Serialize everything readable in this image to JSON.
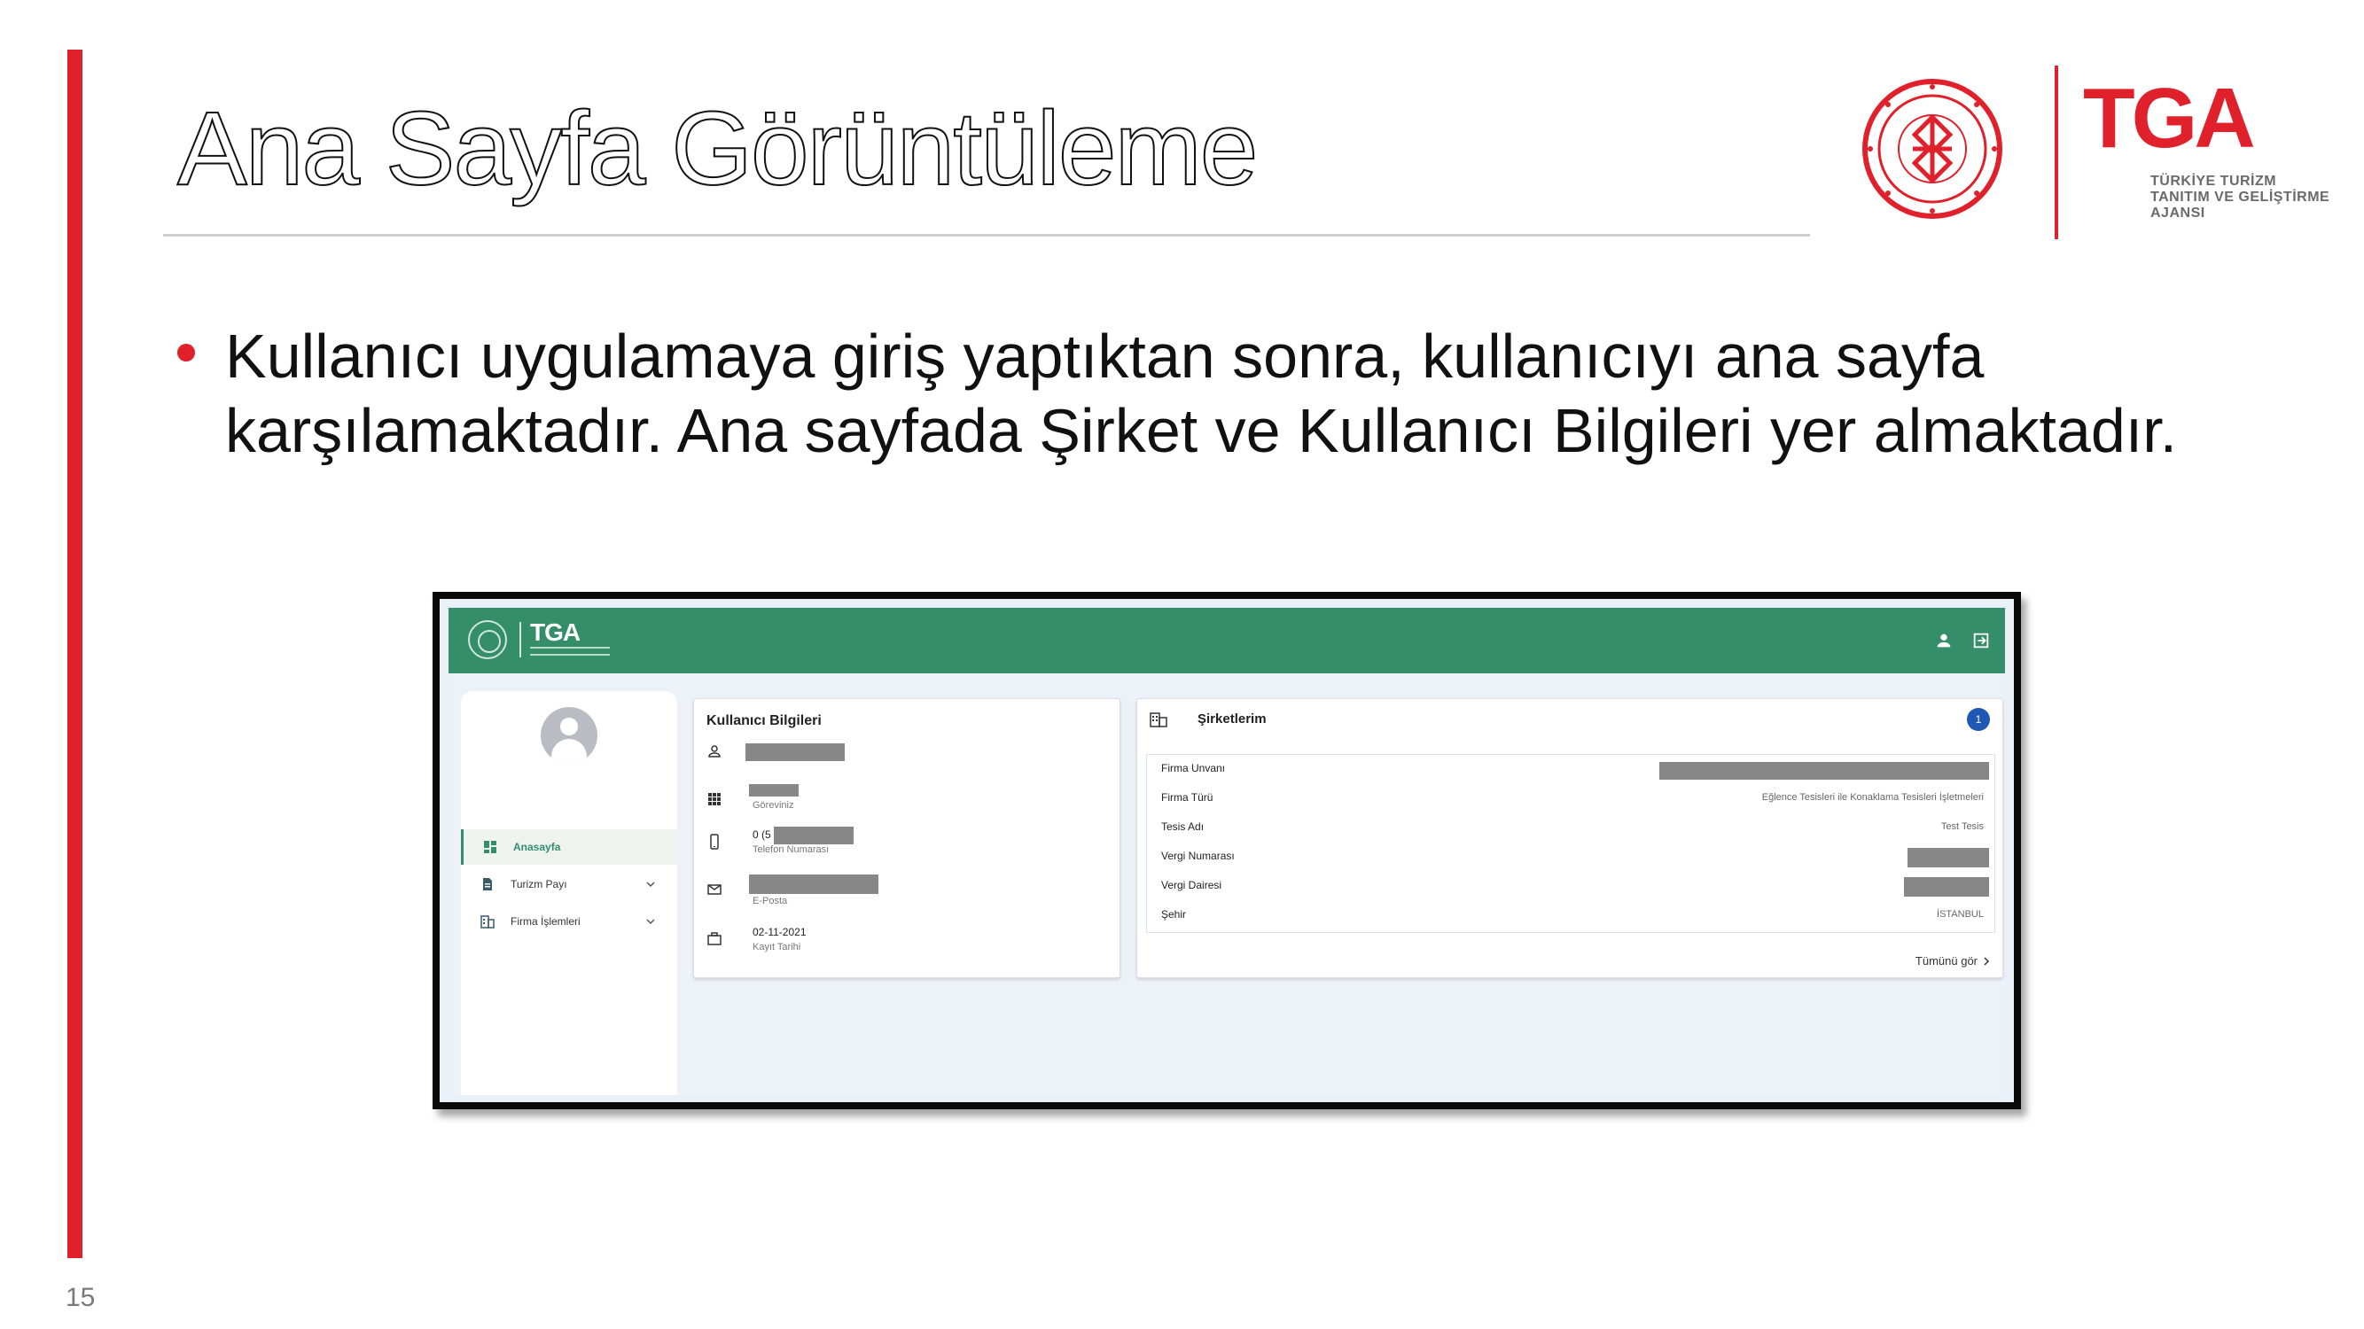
{
  "slide": {
    "title": "Ana Sayfa Görüntüleme",
    "bullet": "Kullanıcı uygulamaya giriş yaptıktan sonra, kullanıcıyı ana sayfa karşılamaktadır. Ana sayfada Şirket ve Kullanıcı Bilgileri yer almaktadır.",
    "page_number": "15"
  },
  "logos": {
    "ministry_seal": "ministry-seal-icon",
    "tga_word": "TGA",
    "tga_subtitle": [
      "TÜRKİYE TURİZM",
      "TANITIM VE GELİŞTİRME",
      "AJANSI"
    ]
  },
  "colors": {
    "accent_red": "#e0202a",
    "app_green": "#358e6a",
    "badge_blue": "#1f57b5",
    "redaction_gray": "#878787"
  },
  "app": {
    "sidebar": {
      "items": [
        {
          "label": "Anasayfa",
          "icon": "dashboard-icon",
          "active": true
        },
        {
          "label": "Turizm Payı",
          "icon": "document-icon",
          "active": false
        },
        {
          "label": "Firma İşlemleri",
          "icon": "building-icon",
          "active": false
        }
      ]
    },
    "user_card": {
      "title": "Kullanıcı Bilgileri",
      "position_label": "Göreviniz",
      "phone_value": "0 (5",
      "phone_label": "Telefon Numarası",
      "email_label": "E-Posta",
      "date_value": "02-11-2021",
      "date_label": "Kayıt Tarihi"
    },
    "companies_card": {
      "title": "Şirketlerim",
      "count": "1",
      "rows": [
        {
          "key": "Firma Unvanı",
          "value": ""
        },
        {
          "key": "Firma Türü",
          "value": "Eğlence Tesisleri ile Konaklama Tesisleri İşletmeleri"
        },
        {
          "key": "Tesis Adı",
          "value": "Test Tesis"
        },
        {
          "key": "Vergi Numarası",
          "value": ""
        },
        {
          "key": "Vergi Dairesi",
          "value": ""
        },
        {
          "key": "Şehir",
          "value": "İSTANBUL"
        }
      ],
      "see_all": "Tümünü gör"
    }
  }
}
